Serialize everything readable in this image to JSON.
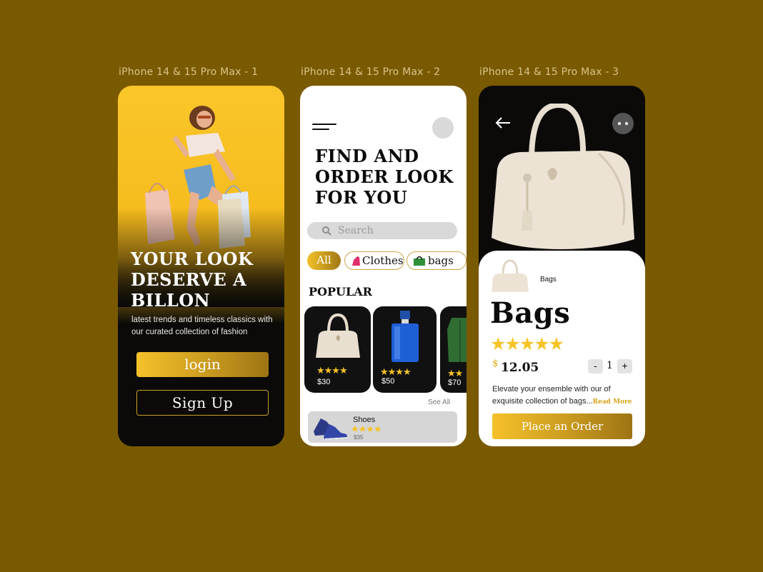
{
  "frames": {
    "f1": "iPhone 14 & 15 Pro Max - 1",
    "f2": "iPhone 14 & 15 Pro Max - 2",
    "f3": "iPhone 14 & 15 Pro Max - 3"
  },
  "screen1": {
    "headline": "YOUR LOOK DESERVE A BILLON",
    "tagline": "latest trends and timeless classics with our curated collection of fashion",
    "login_label": "login",
    "signup_label": "Sign  Up"
  },
  "screen2": {
    "title": "FIND AND ORDER LOOK FOR YOU",
    "search_placeholder": "Search",
    "chips": [
      "All",
      "Clothes",
      "bags"
    ],
    "section_title": "POPULAR",
    "products": [
      {
        "price": "$30",
        "rating": "★★★★",
        "icon": "handbag"
      },
      {
        "price": "$50",
        "rating": "★★★★",
        "icon": "perfume-bottle"
      },
      {
        "price": "$70",
        "rating": "★★",
        "icon": "green-jacket"
      }
    ],
    "see_all": "See All",
    "list_item": {
      "name": "Shoes",
      "rating": "★★★★",
      "price": "$35"
    }
  },
  "screen3": {
    "category": "Bags",
    "title": "Bags",
    "rating": "★★★★★",
    "currency": "$",
    "price": "12.05",
    "qty_minus": "-",
    "qty_value": "1",
    "qty_plus": "+",
    "description": "Elevate your ensemble with our of exquisite collection of bags...",
    "read_more": "Read More",
    "order_label": "Place an Order"
  },
  "colors": {
    "background": "#7a5a00",
    "gold": "#f5c12a",
    "gold_dark": "#9d7414",
    "dark": "#0b0a08"
  }
}
